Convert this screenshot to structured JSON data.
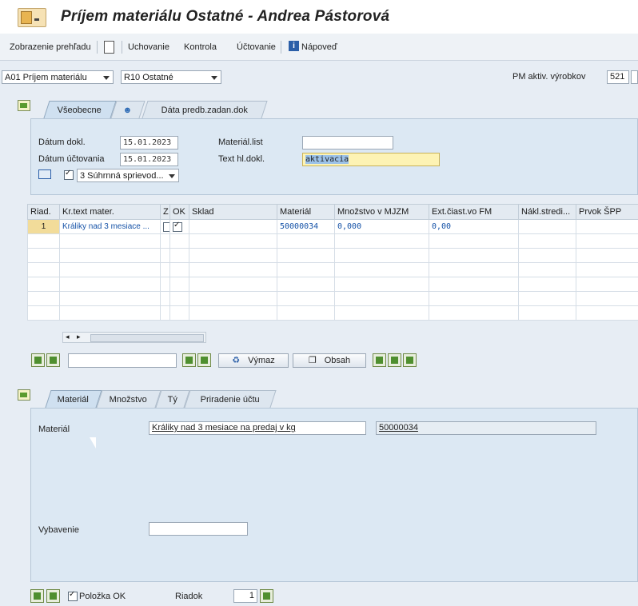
{
  "window": {
    "title": "Príjem materiálu Ostatné - Andrea Pástorová"
  },
  "toolbar": {
    "overview": "Zobrazenie prehľadu",
    "hold": "Uchovanie",
    "check": "Kontrola",
    "post": "Účtovanie",
    "help": "Nápoveď"
  },
  "selectors": {
    "action": "A01 Príjem materiálu",
    "reference": "R10 Ostatné",
    "pm_label": "PM aktiv. výrobkov",
    "pm_value": "521"
  },
  "header_tabs": [
    "Všeobecne",
    "Dáta predb.zadan.dok"
  ],
  "header": {
    "doc_date_label": "Dátum dokl.",
    "doc_date": "15.01.2023",
    "post_date_label": "Dátum účtovania",
    "post_date": "15.01.2023",
    "material_slip_label": "Materiál.list",
    "material_slip": "",
    "header_text_label": "Text hl.dokl.",
    "header_text": "aktivacia",
    "print_option": "3 Súhrnná sprievod..."
  },
  "grid": {
    "columns": [
      "Riad.",
      "Kr.text mater.",
      "Z",
      "OK",
      "Sklad",
      "Materiál",
      "Množstvo v MJZM",
      "Ext.čiast.vo FM",
      "Nákl.stredi...",
      "Prvok ŠPP"
    ],
    "rows": [
      {
        "line": "1",
        "text": "Králiky nad 3 mesiace ...",
        "material": "50000034",
        "qty": "0,000",
        "amount": "0,00",
        "z": false,
        "ok": true
      }
    ]
  },
  "grid_toolbar": {
    "delete": "Výmaz",
    "contents": "Obsah"
  },
  "detail_tabs": [
    "Materiál",
    "Množstvo",
    "Tý",
    "Priradenie účtu"
  ],
  "detail": {
    "material_label": "Materiál",
    "material_desc": "Králiky nad 3 mesiace na predaj v kg",
    "material_number": "50000034",
    "fulfillment_label": "Vybavenie",
    "fulfillment_value": ""
  },
  "footer": {
    "item_ok": "Položka OK",
    "row_label": "Riadok",
    "row_value": "1"
  }
}
